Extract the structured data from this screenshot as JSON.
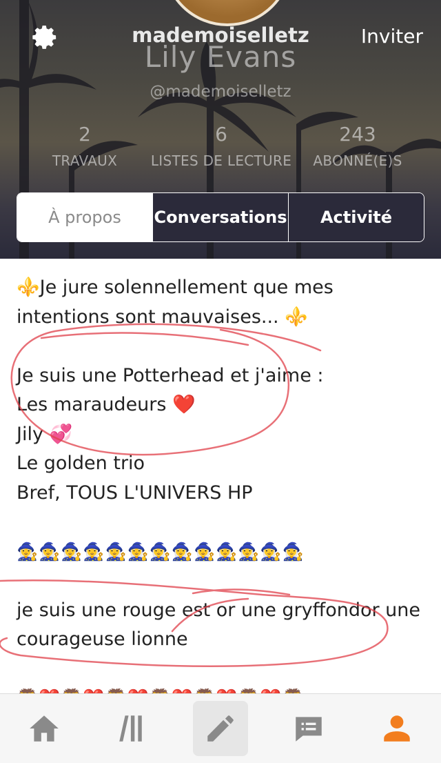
{
  "profile": {
    "username": "mademoiselletz",
    "display_name": "Lily Evans",
    "handle": "@mademoiselletz",
    "invite_label": "Inviter"
  },
  "stats": [
    {
      "value": "2",
      "label": "TRAVAUX"
    },
    {
      "value": "6",
      "label": "LISTES DE LECTURE"
    },
    {
      "value": "243",
      "label": "ABONNÉ(E)S"
    }
  ],
  "tabs": [
    {
      "label": "À propos",
      "selected": true
    },
    {
      "label": "Conversations",
      "selected": false
    },
    {
      "label": "Activité",
      "selected": false
    }
  ],
  "about": {
    "lines": [
      "⚜️Je jure solennellement que mes",
      "intentions sont mauvaises... ⚜️",
      "",
      "Je suis une Potterhead et j'aime :",
      "Les maraudeurs ❤️",
      "Jily 💞",
      "Le golden trio",
      "Bref, TOUS L'UNIVERS HP",
      "",
      "🧙‍♀️🧙‍♀️🧙‍♀️🧙‍♀️🧙‍♀️🧙‍♀️🧙‍♀️🧙‍♀️🧙‍♀️🧙‍♀️🧙‍♀️🧙‍♀️🧙‍♀️",
      "",
      " je suis une rouge est or une gryffondor une",
      "courageuse lionne",
      "",
      "🦁❤️🦁❤️🦁❤️🦁❤️🦁❤️🦁❤️🦁"
    ]
  },
  "nav": [
    {
      "icon": "home-icon",
      "active": false
    },
    {
      "icon": "library-icon",
      "active": false
    },
    {
      "icon": "write-icon",
      "active": false
    },
    {
      "icon": "messages-icon",
      "active": false
    },
    {
      "icon": "profile-icon",
      "active": true
    }
  ],
  "colors": {
    "accent": "#f27d1e",
    "nav_icon": "#8a8a8a",
    "header_dark": "#2b2a3a",
    "annotation_ink": "#e0404a"
  }
}
